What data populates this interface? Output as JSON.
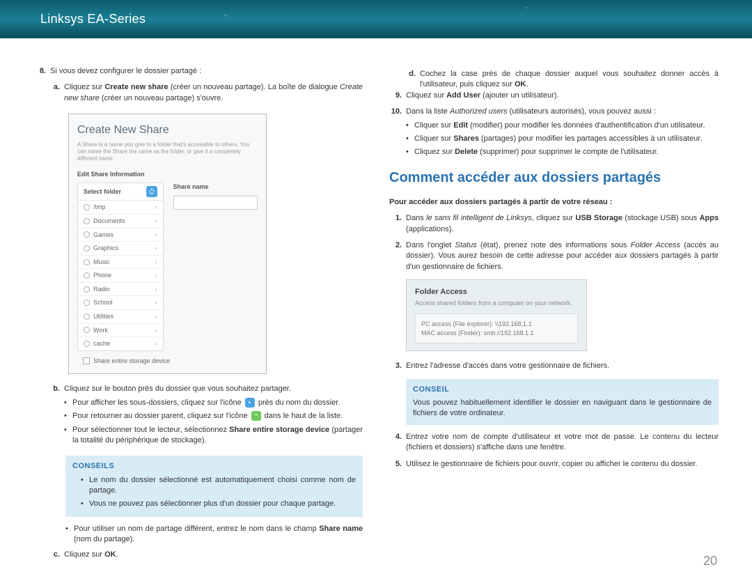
{
  "header": {
    "title": "Linksys EA-Series"
  },
  "page_number": "20",
  "left": {
    "step8": {
      "num": "8.",
      "text": "Si vous devez configurer le dossier partagé :",
      "a": {
        "letter": "a.",
        "line1": "Cliquez sur ",
        "bold1": "Create new share",
        "line2": " (créer un nouveau partage). La boîte de dialogue ",
        "ital1": "Create new share",
        "line3": " (créer un nouveau partage) s'ouvre."
      },
      "b": {
        "letter": "b.",
        "text": "Cliquez sur le bouton près du dossier que vous souhaitez partager.",
        "bullets": [
          {
            "pre": "Pour afficher les sous-dossiers, cliquez sur l'icône ",
            "icon": "chevron",
            "post": " près du nom du dossier."
          },
          {
            "pre": "Pour retourner au dossier parent, cliquez sur l'icône ",
            "icon": "refresh",
            "post": " dans le haut de la liste."
          },
          {
            "pre": "Pour sélectionner tout le lecteur, sélectionnez ",
            "bold": "Share entire storage device",
            "post": " (partager la totalité du périphérique de stockage)."
          }
        ]
      },
      "tips_title": "CONSEILS",
      "tips": [
        "Le nom du dossier sélectionné est automatiquement choisi comme nom de partage.",
        "Vous ne pouvez pas sélectionner plus d'un dossier pour chaque partage."
      ],
      "after_tip": {
        "pre": "Pour utiliser un nom de partage différent, entrez le nom dans le champ ",
        "bold": "Share name",
        "post": " (nom du partage)."
      },
      "c": {
        "letter": "c.",
        "pre": "Cliquez sur ",
        "bold": "OK",
        "post": "."
      }
    },
    "screenshot": {
      "title": "Create New Share",
      "desc": "A Share is a name you give to a folder that's accessible to others. You can name the Share the same as the folder, or give it a completely different name.",
      "edit_label": "Edit Share Information",
      "select_folder": "Select folder",
      "share_name": "Share name",
      "folders": [
        "/tmp",
        "Documents",
        "Games",
        "Graphics",
        "Music",
        "Phone",
        "Radio",
        "School",
        "Utilities",
        "Work",
        "cache"
      ],
      "share_entire": "Share entire storage device"
    }
  },
  "right": {
    "d": {
      "letter": "d.",
      "pre": "Cochez la case près de chaque dossier auquel vous souhaitez donner accès à l'utilisateur, puis cliquez sur ",
      "bold": "OK",
      "post": "."
    },
    "step9": {
      "num": "9.",
      "pre": "Cliquez sur ",
      "bold": "Add User",
      "post": " (ajouter un utilisateur)."
    },
    "step10": {
      "num": "10.",
      "pre": "Dans la liste ",
      "ital": "Authorized users",
      "post": " (utilisateurs autorisés), vous pouvez aussi :",
      "bullets": [
        {
          "pre": "Cliquer sur ",
          "bold": "Edit",
          "post": " (modifier) pour modifier les données d'authentification d'un utilisateur."
        },
        {
          "pre": "Cliquer sur ",
          "bold": "Shares",
          "post": " (partages) pour modifier les partages accessibles à un utilisateur."
        },
        {
          "pre": "Cliquez sur ",
          "bold": "Delete",
          "post": " (supprimer) pour supprimer le compte de l'utilisateur."
        }
      ]
    },
    "section_title": "Comment accéder aux dossiers partagés",
    "intro": "Pour accéder aux dossiers partagés à partir de votre réseau :",
    "s1": {
      "num": "1.",
      "pre": "Dans ",
      "ital": "le sans fil intelligent de Linksys",
      "mid": ", cliquez sur ",
      "bold1": "USB Storage",
      "mid2": " (stockage USB) sous ",
      "bold2": "Apps",
      "post": " (applications)."
    },
    "s2": {
      "num": "2.",
      "pre": "Dans l'onglet ",
      "ital1": "Status",
      "mid1": " (état), prenez note des informations sous ",
      "ital2": "Folder Access",
      "post": " (accès au dossier). Vous aurez besoin de cette adresse pour accéder aux dossiers partagés à partir d'un gestionnaire de fichiers."
    },
    "panel": {
      "title": "Folder Access",
      "desc": "Access shared folders from a computer on your network.",
      "pc": "PC access (File explorer): \\\\192.168.1.1",
      "mac": "MAC access (Finder): smb://192.168.1.1"
    },
    "s3": {
      "num": "3.",
      "text": "Entrez l'adresse d'accès dans votre gestionnaire de fichiers."
    },
    "tip_title": "CONSEIL",
    "tip_text": "Vous pouvez habituellement identifier le dossier en naviguant dans le gestionnaire de fichiers de votre ordinateur.",
    "s4": {
      "num": "4.",
      "text": "Entrez votre nom de compte d'utilisateur et votre mot de passe. Le contenu du lecteur (fichiers et dossiers) s'affiche dans une fenêtre."
    },
    "s5": {
      "num": "5.",
      "text": "Utilisez le gestionnaire de fichiers pour ouvrir, copier ou afficher le contenu du dossier."
    }
  }
}
